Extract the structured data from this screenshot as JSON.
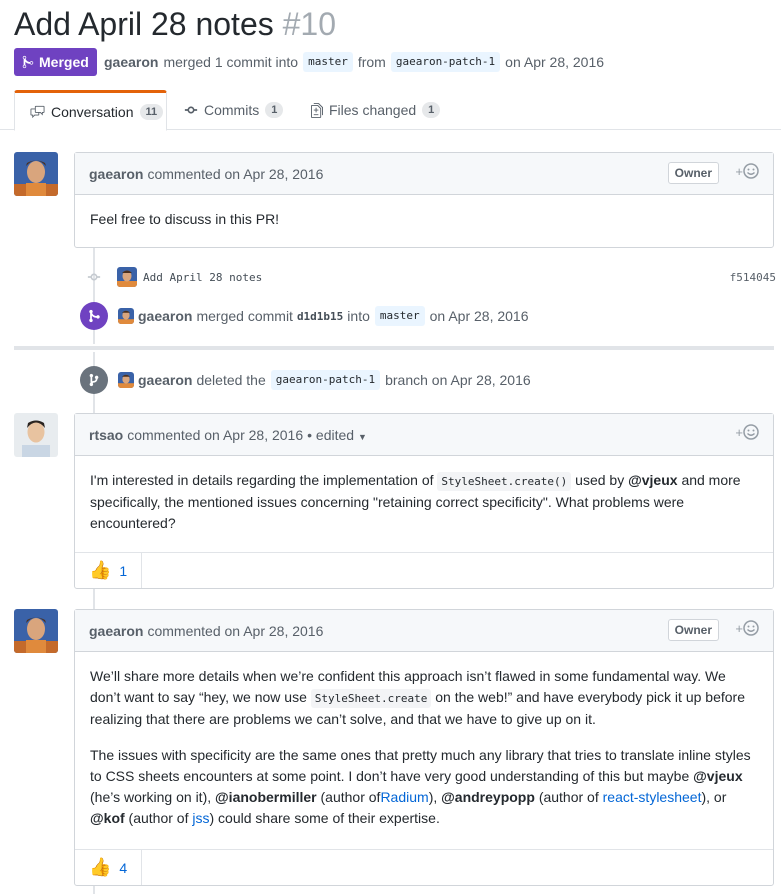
{
  "pr": {
    "title": "Add April 28 notes",
    "number": "#10",
    "state": "Merged",
    "author": "gaearon",
    "merged_text": "merged 1 commit into",
    "base_branch": "master",
    "from_text": "from",
    "head_branch": "gaearon-patch-1",
    "date_text": "on Apr 28, 2016"
  },
  "tabs": [
    {
      "label": "Conversation",
      "count": "11",
      "icon": "comment-discussion-icon"
    },
    {
      "label": "Commits",
      "count": "1",
      "icon": "git-commit-icon"
    },
    {
      "label": "Files changed",
      "count": "1",
      "icon": "file-diff-icon"
    }
  ],
  "comments": [
    {
      "author": "gaearon",
      "meta": "commented on Apr 28, 2016",
      "badge": "Owner",
      "paragraphs": [
        "Feel free to discuss in this PR!"
      ]
    },
    {
      "author": "rtsao",
      "meta": "commented on Apr 28, 2016",
      "edited": "• edited",
      "p1_a": "I'm interested in details regarding the implementation of",
      "p1_code": "StyleSheet.create()",
      "p1_b": "used by",
      "p1_mention": "@vjeux",
      "p1_c": "and more specifically, the mentioned issues concerning \"retaining correct specificity\". What problems were encountered?",
      "reaction_count": "1"
    },
    {
      "author": "gaearon",
      "meta": "commented on Apr 28, 2016",
      "badge": "Owner",
      "p1_a": "We’ll share more details when we’re confident this approach isn’t flawed in some fundamental way. We don’t want to say “hey, we now use",
      "p1_code": "StyleSheet.create",
      "p1_b": "on the web!” and have everybody pick it up before realizing that there are problems we can’t solve, and that we have to give up on it.",
      "p2_a": "The issues with specificity are the same ones that pretty much any library that tries to translate inline styles to CSS sheets encounters at some point. I don’t have very good understanding of this but maybe",
      "p2_m1": "@vjeux",
      "p2_b": "(he’s working on it),",
      "p2_m2": "@ianobermiller",
      "p2_c": "(author of",
      "p2_l1": "Radium",
      "p2_d": "),",
      "p2_m3": "@andreypopp",
      "p2_e": "(author of",
      "p2_l2": "react-stylesheet",
      "p2_f": "), or",
      "p2_m4": "@kof",
      "p2_g": "(author of",
      "p2_l3": "jss",
      "p2_h": ") could share some of their expertise.",
      "reaction_count": "4"
    }
  ],
  "events": {
    "commit": {
      "message": "Add April 28 notes",
      "sha": "f514045"
    },
    "merged": {
      "author": "gaearon",
      "text": "merged commit",
      "sha": "d1d1b15",
      "into": "into",
      "branch": "master",
      "date": "on Apr 28, 2016"
    },
    "deleted": {
      "author": "gaearon",
      "text": "deleted the",
      "branch": "gaearon-patch-1",
      "suffix": "branch on Apr 28, 2016"
    }
  },
  "colors": {
    "merged_purple": "#6f42c1",
    "link_blue": "#0366d6",
    "tab_accent": "#e36209"
  }
}
